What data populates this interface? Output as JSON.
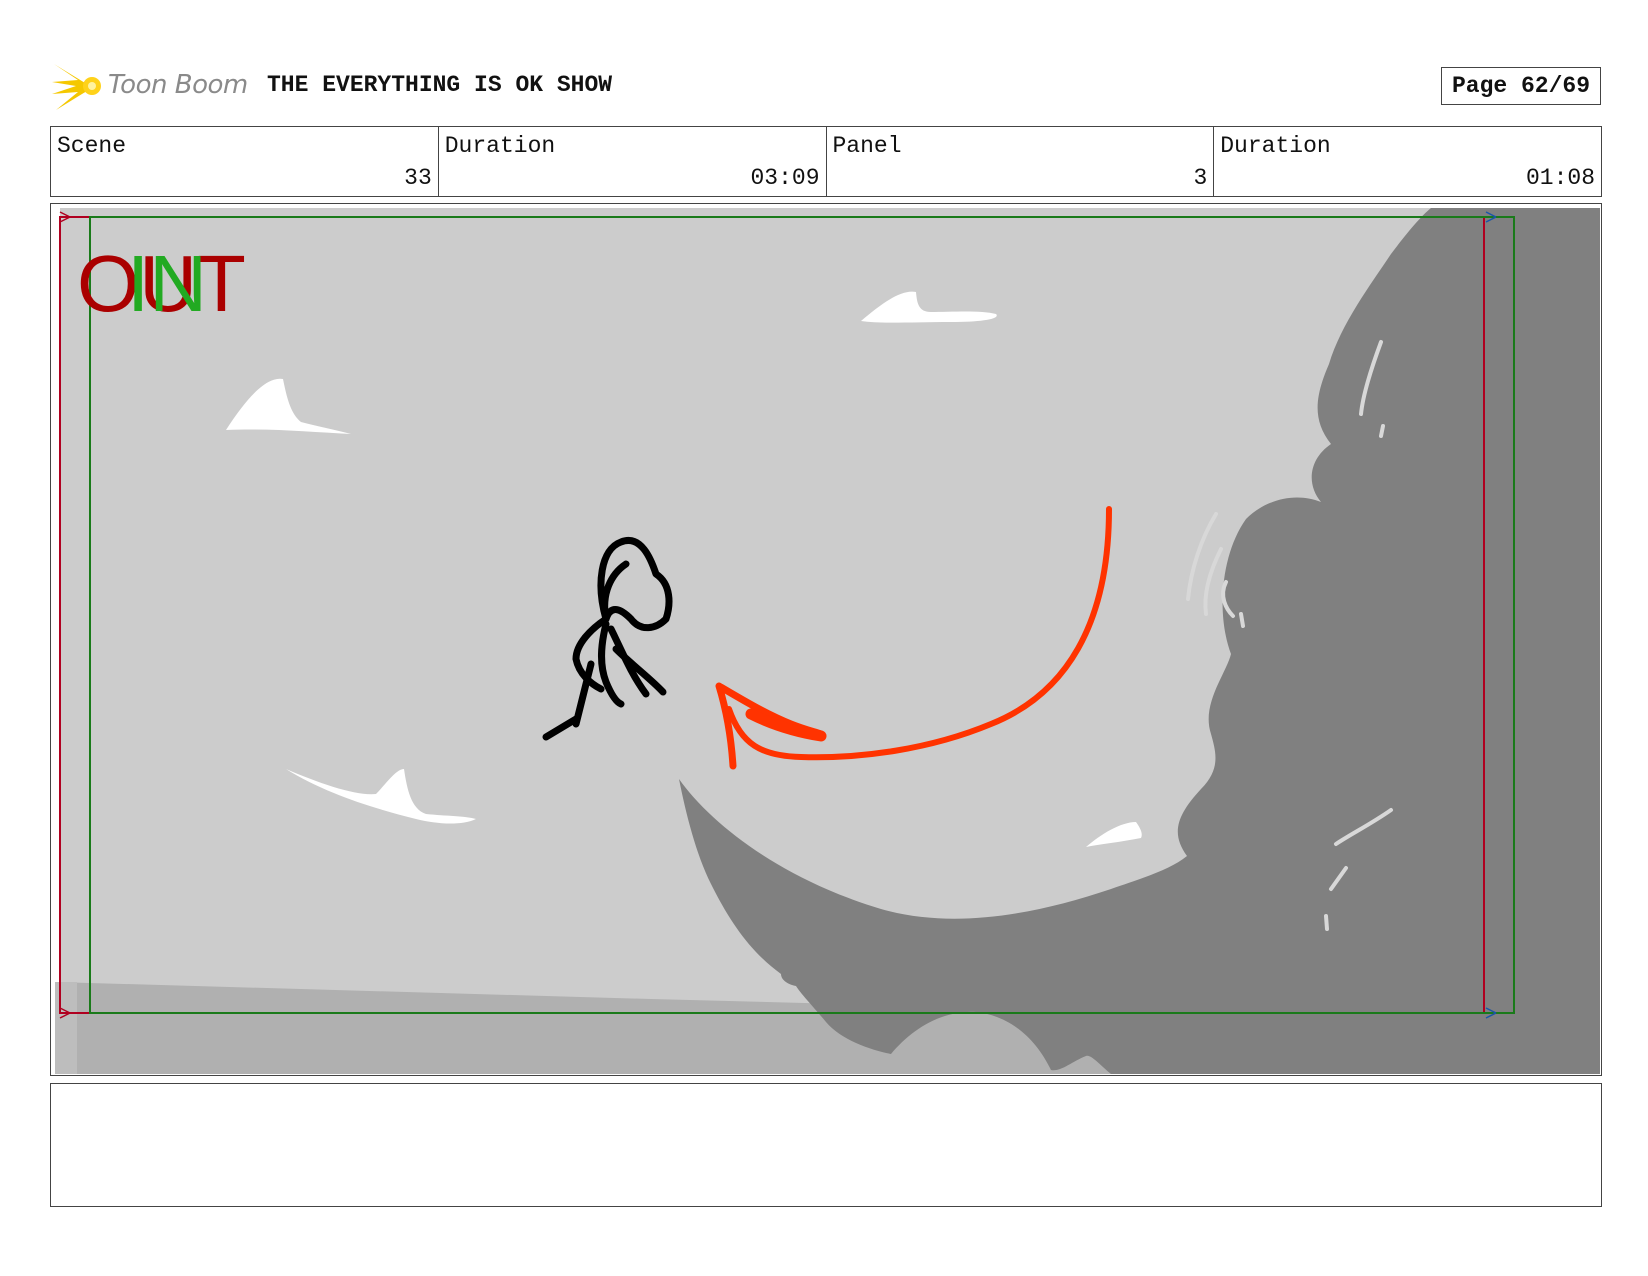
{
  "header": {
    "logo_text": "Toon Boom",
    "show_title": "THE EVERYTHING IS OK SHOW",
    "page_label": "Page 62/69"
  },
  "info": {
    "scene_label": "Scene",
    "scene_value": "33",
    "scene_duration_label": "Duration",
    "scene_duration_value": "03:09",
    "panel_label": "Panel",
    "panel_value": "3",
    "panel_duration_label": "Duration",
    "panel_duration_value": "01:08"
  },
  "panel": {
    "out_marker": "OUT",
    "in_marker": "IN",
    "colors": {
      "sky": "#cccccc",
      "ground": "#b0b0b0",
      "creature": "#808080",
      "clouds": "#ffffff",
      "arrow": "#ff3300",
      "out_marker": "#aa0000",
      "in_marker": "#22aa22",
      "safe_frame_red": "#b00020",
      "safe_frame_green": "#1a7a1a"
    }
  },
  "notes": {
    "text": ""
  }
}
